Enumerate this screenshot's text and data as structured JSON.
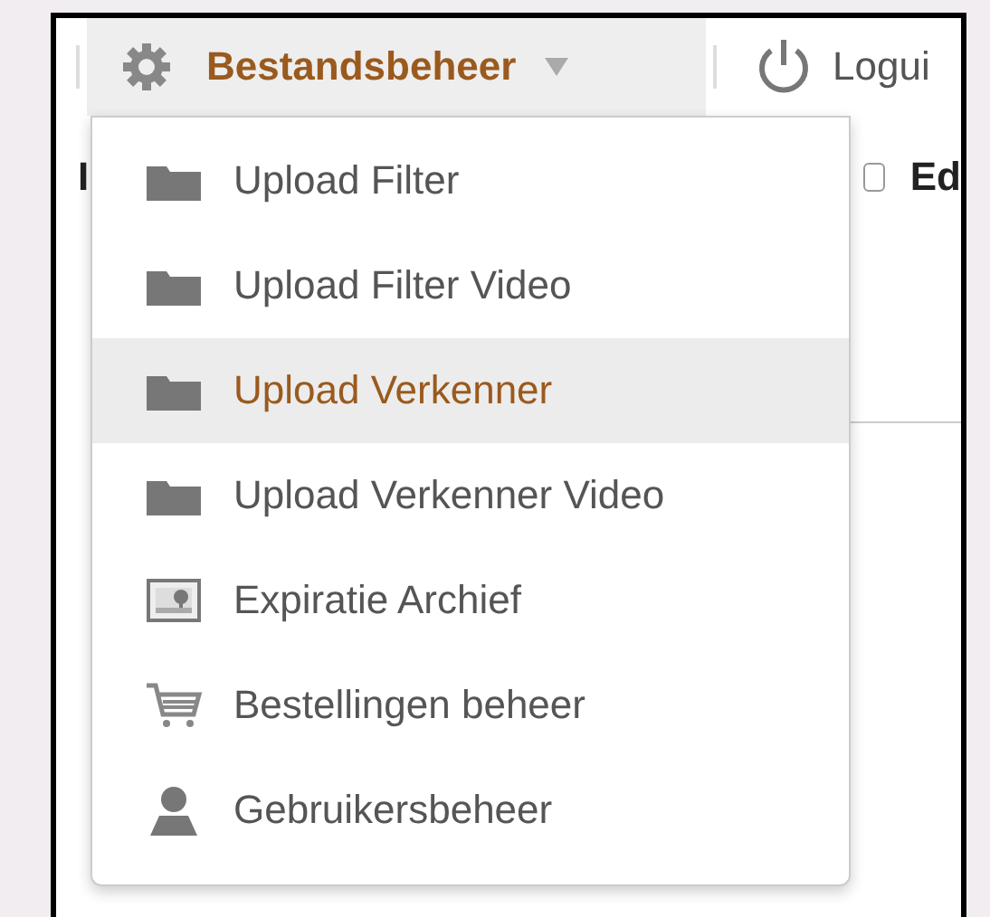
{
  "nav": {
    "menu": {
      "label": "Bestandsbeheer",
      "expanded": true
    },
    "logout": {
      "label": "Logui"
    }
  },
  "background": {
    "label": "I",
    "checkbox": {
      "label": "Ed",
      "checked": false
    }
  },
  "dropdown": {
    "items": [
      {
        "label": "Upload Filter",
        "kind": "folder",
        "selected": false
      },
      {
        "label": "Upload Filter Video",
        "kind": "folder",
        "selected": false
      },
      {
        "label": "Upload Verkenner",
        "kind": "folder",
        "selected": true
      },
      {
        "label": "Upload Verkenner Video",
        "kind": "folder",
        "selected": false
      },
      {
        "label": "Expiratie Archief",
        "kind": "image",
        "selected": false
      },
      {
        "label": "Bestellingen beheer",
        "kind": "cart",
        "selected": false
      },
      {
        "label": "Gebruikersbeheer",
        "kind": "user",
        "selected": false
      }
    ]
  }
}
